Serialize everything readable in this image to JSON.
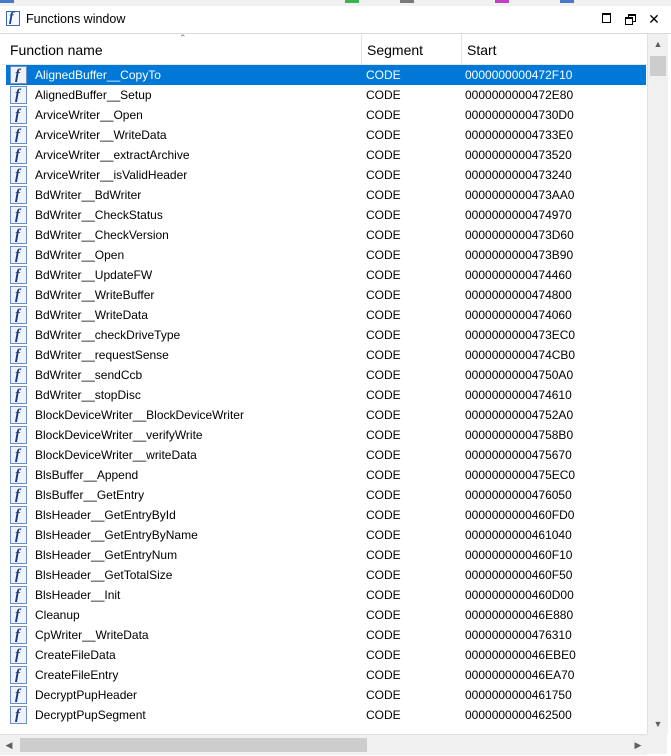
{
  "window": {
    "title": "Functions window",
    "icon": "function-f-icon",
    "accent": "#0078d7"
  },
  "columns": {
    "name": "Function name",
    "segment": "Segment",
    "start": "Start"
  },
  "rows": [
    {
      "name": "AlignedBuffer__CopyTo",
      "segment": "CODE",
      "start": "0000000000472F10",
      "selected": true
    },
    {
      "name": "AlignedBuffer__Setup",
      "segment": "CODE",
      "start": "0000000000472E80"
    },
    {
      "name": "ArviceWriter__Open",
      "segment": "CODE",
      "start": "00000000004730D0"
    },
    {
      "name": "ArviceWriter__WriteData",
      "segment": "CODE",
      "start": "00000000004733E0"
    },
    {
      "name": "ArviceWriter__extractArchive",
      "segment": "CODE",
      "start": "0000000000473520"
    },
    {
      "name": "ArviceWriter__isValidHeader",
      "segment": "CODE",
      "start": "0000000000473240"
    },
    {
      "name": "BdWriter__BdWriter",
      "segment": "CODE",
      "start": "0000000000473AA0"
    },
    {
      "name": "BdWriter__CheckStatus",
      "segment": "CODE",
      "start": "0000000000474970"
    },
    {
      "name": "BdWriter__CheckVersion",
      "segment": "CODE",
      "start": "0000000000473D60"
    },
    {
      "name": "BdWriter__Open",
      "segment": "CODE",
      "start": "0000000000473B90"
    },
    {
      "name": "BdWriter__UpdateFW",
      "segment": "CODE",
      "start": "0000000000474460"
    },
    {
      "name": "BdWriter__WriteBuffer",
      "segment": "CODE",
      "start": "0000000000474800"
    },
    {
      "name": "BdWriter__WriteData",
      "segment": "CODE",
      "start": "0000000000474060"
    },
    {
      "name": "BdWriter__checkDriveType",
      "segment": "CODE",
      "start": "0000000000473EC0"
    },
    {
      "name": "BdWriter__requestSense",
      "segment": "CODE",
      "start": "0000000000474CB0"
    },
    {
      "name": "BdWriter__sendCcb",
      "segment": "CODE",
      "start": "00000000004750A0"
    },
    {
      "name": "BdWriter__stopDisc",
      "segment": "CODE",
      "start": "0000000000474610"
    },
    {
      "name": "BlockDeviceWriter__BlockDeviceWriter",
      "segment": "CODE",
      "start": "00000000004752A0"
    },
    {
      "name": "BlockDeviceWriter__verifyWrite",
      "segment": "CODE",
      "start": "00000000004758B0"
    },
    {
      "name": "BlockDeviceWriter__writeData",
      "segment": "CODE",
      "start": "0000000000475670"
    },
    {
      "name": "BlsBuffer__Append",
      "segment": "CODE",
      "start": "0000000000475EC0"
    },
    {
      "name": "BlsBuffer__GetEntry",
      "segment": "CODE",
      "start": "0000000000476050"
    },
    {
      "name": "BlsHeader__GetEntryById",
      "segment": "CODE",
      "start": "0000000000460FD0"
    },
    {
      "name": "BlsHeader__GetEntryByName",
      "segment": "CODE",
      "start": "0000000000461040"
    },
    {
      "name": "BlsHeader__GetEntryNum",
      "segment": "CODE",
      "start": "0000000000460F10"
    },
    {
      "name": "BlsHeader__GetTotalSize",
      "segment": "CODE",
      "start": "0000000000460F50"
    },
    {
      "name": "BlsHeader__Init",
      "segment": "CODE",
      "start": "0000000000460D00"
    },
    {
      "name": "Cleanup",
      "segment": "CODE",
      "start": "000000000046E880"
    },
    {
      "name": "CpWriter__WriteData",
      "segment": "CODE",
      "start": "0000000000476310"
    },
    {
      "name": "CreateFileData",
      "segment": "CODE",
      "start": "000000000046EBE0"
    },
    {
      "name": "CreateFileEntry",
      "segment": "CODE",
      "start": "000000000046EA70"
    },
    {
      "name": "DecryptPupHeader",
      "segment": "CODE",
      "start": "0000000000461750"
    },
    {
      "name": "DecryptPupSegment",
      "segment": "CODE",
      "start": "0000000000462500"
    }
  ]
}
